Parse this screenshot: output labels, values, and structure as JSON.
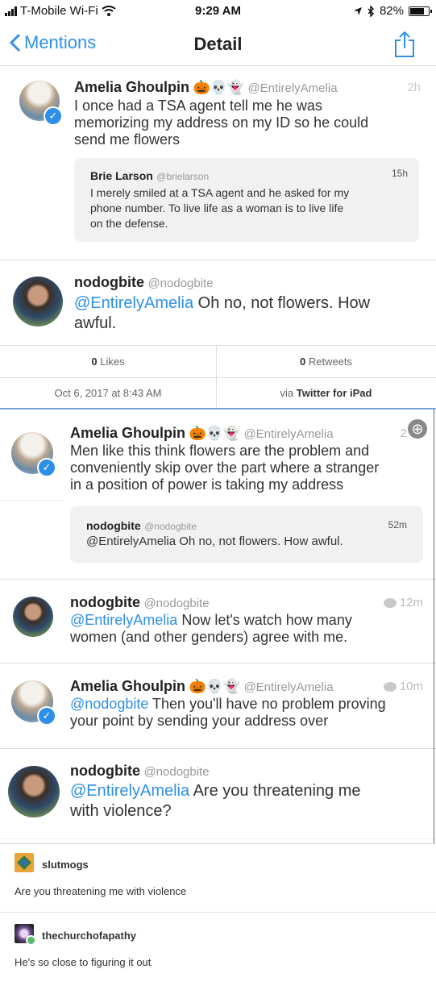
{
  "status": {
    "carrier": "T-Mobile Wi-Fi",
    "time": "9:29 AM",
    "battery": "82%",
    "battery_level": 0.82
  },
  "nav": {
    "back_label": "Mentions",
    "title": "Detail"
  },
  "main_tweet": {
    "name": "Amelia Ghoulpin",
    "emojis": "🎃💀👻",
    "handle": "@EntirelyAmelia",
    "age": "2h",
    "text_lines": [
      "I once had a TSA agent tell me he was",
      "memorizing my address on my ID so he could",
      "send me flowers"
    ],
    "quote": {
      "name": "Brie Larson",
      "handle": "@brielarson",
      "age": "15h",
      "text_lines": [
        "I merely smiled at a TSA agent and he asked for my",
        "phone number. To live life as a woman is to live life",
        "on the defense."
      ]
    }
  },
  "detail_tweet": {
    "name": "nodogbite",
    "handle": "@nodogbite",
    "mention": "@EntirelyAmelia",
    "text_line1": " Oh no, not flowers.  How",
    "text_line2": "awful.",
    "likes_count": "0",
    "likes_label": "Likes",
    "retweets_count": "0",
    "retweets_label": "Retweets",
    "timestamp": "Oct 6, 2017 at 8:43 AM",
    "via_prefix": "via",
    "via_app": "Twitter for iPad"
  },
  "second": {
    "tweet1": {
      "name": "Amelia Ghoulpin",
      "emojis": "🎃💀👻",
      "handle": "@EntirelyAmelia",
      "age": "2",
      "text_lines": [
        "Men like this think flowers are the problem and",
        "conveniently skip over the part where a stranger",
        "in a position of power is taking my address"
      ],
      "quote": {
        "name": "nodogbite",
        "handle": "@nodogbite",
        "age": "52m",
        "text": "@EntirelyAmelia Oh no, not flowers.  How awful."
      }
    },
    "tweet2": {
      "name": "nodogbite",
      "handle": "@nodogbite",
      "age": "12m",
      "mention": "@EntirelyAmelia",
      "text_line1": " Now let's watch how many",
      "text_line2": "women (and other genders) agree with me."
    },
    "tweet3": {
      "name": "Amelia Ghoulpin",
      "emojis": "🎃💀👻",
      "handle": "@EntirelyAmelia",
      "age": "10m",
      "mention": "@nodogbite",
      "text_line1": " Then you'll have no problem proving",
      "text_line2": "your point by sending your address over"
    },
    "tweet4": {
      "name": "nodogbite",
      "handle": "@nodogbite",
      "mention": "@EntirelyAmelia",
      "text_line1": " Are you threatening me",
      "text_line2": "with violence?"
    }
  },
  "tumblr": [
    {
      "username": "slutmogs",
      "text": "Are you threatening me with violence"
    },
    {
      "username": "thechurchofapathy",
      "text": "He's so close to figuring it out"
    }
  ]
}
